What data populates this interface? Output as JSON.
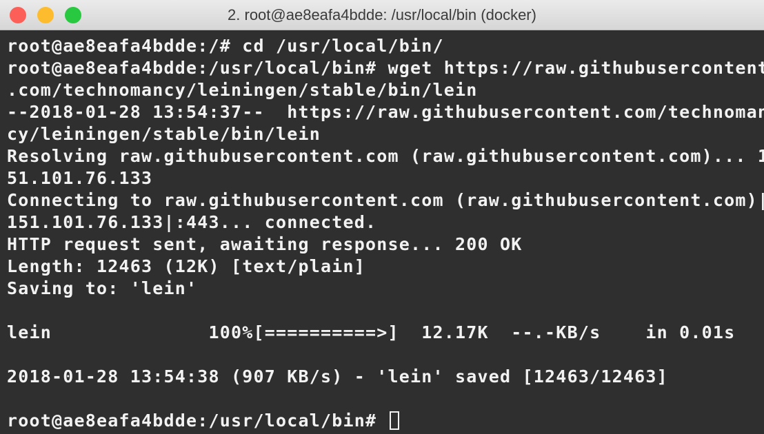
{
  "window": {
    "title": "2. root@ae8eafa4bdde: /usr/local/bin (docker)",
    "controls": {
      "close_color": "#fc5f57",
      "minimize_color": "#fdbc2e",
      "zoom_color": "#28c840"
    }
  },
  "terminal": {
    "background": "#2f2f2f",
    "foreground": "#f2f2f2",
    "lines": [
      "root@ae8eafa4bdde:/# cd /usr/local/bin/",
      "root@ae8eafa4bdde:/usr/local/bin# wget https://raw.githubusercontent",
      ".com/technomancy/leiningen/stable/bin/lein",
      "--2018-01-28 13:54:37--  https://raw.githubusercontent.com/technoman",
      "cy/leiningen/stable/bin/lein",
      "Resolving raw.githubusercontent.com (raw.githubusercontent.com)... 1",
      "51.101.76.133",
      "Connecting to raw.githubusercontent.com (raw.githubusercontent.com)|",
      "151.101.76.133|:443... connected.",
      "HTTP request sent, awaiting response... 200 OK",
      "Length: 12463 (12K) [text/plain]",
      "Saving to: 'lein'",
      "",
      "lein              100%[==========>]  12.17K  --.-KB/s    in 0.01s",
      "",
      "2018-01-28 13:54:38 (907 KB/s) - 'lein' saved [12463/12463]",
      "",
      "root@ae8eafa4bdde:/usr/local/bin# "
    ]
  }
}
